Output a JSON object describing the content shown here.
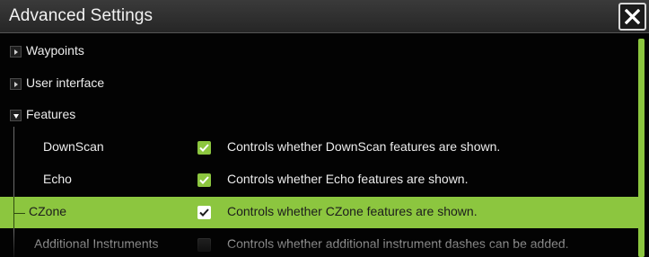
{
  "window": {
    "title": "Advanced Settings",
    "close_icon": "close-icon"
  },
  "colors": {
    "accent": "#8cc63f",
    "background": "#030303",
    "titlebar": "#2f2f2f"
  },
  "tree": {
    "waypoints": {
      "label": "Waypoints",
      "expanded": false
    },
    "user_interface": {
      "label": "User interface",
      "expanded": false
    },
    "features": {
      "label": "Features",
      "expanded": true,
      "items": [
        {
          "label": "DownScan",
          "checked": true,
          "description": "Controls whether DownScan features are shown.",
          "selected": false
        },
        {
          "label": "Echo",
          "checked": true,
          "description": "Controls whether Echo features are shown.",
          "selected": false
        },
        {
          "label": "CZone",
          "checked": true,
          "description": "Controls whether CZone features are shown.",
          "selected": true
        },
        {
          "label": "Additional Instruments",
          "checked": false,
          "description": "Controls whether additional instrument dashes can be added.",
          "selected": false
        }
      ]
    }
  }
}
